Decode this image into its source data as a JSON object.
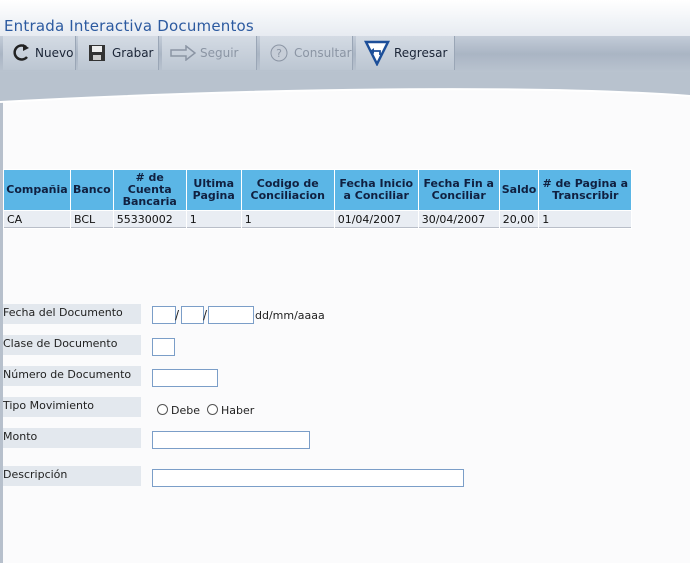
{
  "app": {
    "title": "Entrada Interactiva Documentos"
  },
  "toolbar": {
    "buttons": [
      {
        "label": "Nuevo",
        "icon": "new-arrow-icon",
        "enabled": true
      },
      {
        "label": "Grabar",
        "icon": "save-disk-icon",
        "enabled": true
      },
      {
        "label": "Seguir",
        "icon": "arrow-right-icon",
        "enabled": false
      },
      {
        "label": "Consultar",
        "icon": "help-question-icon",
        "enabled": false
      },
      {
        "label": "Regresar",
        "icon": "back-arrow-icon",
        "enabled": true
      }
    ]
  },
  "table": {
    "headers": [
      "Compañia",
      "Banco",
      "# de Cuenta Bancaria",
      "Ultima Pagina",
      "Codigo de Conciliacion",
      "Fecha Inicio a Conciliar",
      "Fecha Fin a Conciliar",
      "Saldo",
      "# de Pagina a Transcribir"
    ],
    "rows": [
      [
        "CA",
        "BCL",
        "55330002",
        "1",
        "1",
        "01/04/2007",
        "30/04/2007",
        "20,00",
        "1"
      ]
    ]
  },
  "form": {
    "fecha_documento": {
      "label": "Fecha del Documento",
      "day": "",
      "month": "",
      "year": "",
      "separator": "/",
      "format_hint": "dd/mm/aaaa"
    },
    "clase_documento": {
      "label": "Clase de Documento",
      "value": ""
    },
    "numero_documento": {
      "label": "Número de Documento",
      "value": ""
    },
    "tipo_movimiento": {
      "label": "Tipo Movimiento",
      "options": [
        "Debe",
        "Haber"
      ],
      "selected": null
    },
    "monto": {
      "label": "Monto",
      "value": ""
    },
    "descripcion": {
      "label": "Descripción",
      "value": ""
    }
  },
  "colors": {
    "title": "#2c5aa0",
    "header_bg": "#5bb6e6",
    "toolbar": "#b3bdca"
  }
}
